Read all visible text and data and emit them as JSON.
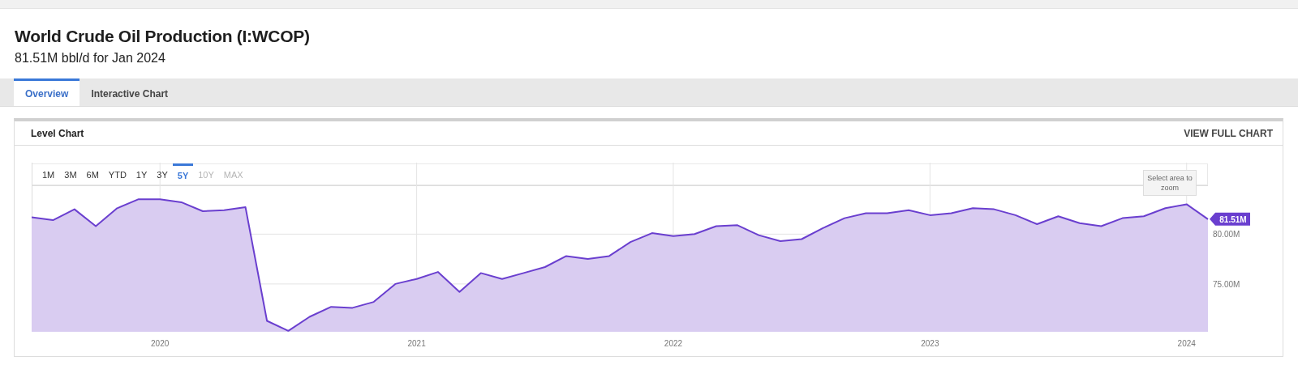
{
  "header": {
    "title": "World Crude Oil Production (I:WCOP)",
    "subtitle": "81.51M bbl/d for Jan 2024"
  },
  "tabs": [
    {
      "label": "Overview",
      "selected": true
    },
    {
      "label": "Interactive Chart",
      "selected": false
    }
  ],
  "card": {
    "title": "Level Chart",
    "action": "VIEW FULL CHART",
    "ranges": [
      {
        "label": "1M",
        "selected": false,
        "disabled": false
      },
      {
        "label": "3M",
        "selected": false,
        "disabled": false
      },
      {
        "label": "6M",
        "selected": false,
        "disabled": false
      },
      {
        "label": "YTD",
        "selected": false,
        "disabled": false
      },
      {
        "label": "1Y",
        "selected": false,
        "disabled": false
      },
      {
        "label": "3Y",
        "selected": false,
        "disabled": false
      },
      {
        "label": "5Y",
        "selected": true,
        "disabled": false
      },
      {
        "label": "10Y",
        "selected": false,
        "disabled": true
      },
      {
        "label": "MAX",
        "selected": false,
        "disabled": true
      }
    ],
    "zoom_hint": "Select area to zoom",
    "current_value": "81.51M",
    "chart_data": {
      "type": "area",
      "x": [
        2019.5,
        2019.583,
        2019.667,
        2019.75,
        2019.833,
        2019.917,
        2020,
        2020.083,
        2020.167,
        2020.25,
        2020.333,
        2020.417,
        2020.5,
        2020.583,
        2020.667,
        2020.75,
        2020.833,
        2020.917,
        2021,
        2021.083,
        2021.167,
        2021.25,
        2021.333,
        2021.417,
        2021.5,
        2021.583,
        2021.667,
        2021.75,
        2021.833,
        2021.917,
        2022,
        2022.083,
        2022.167,
        2022.25,
        2022.333,
        2022.417,
        2022.5,
        2022.583,
        2022.667,
        2022.75,
        2022.833,
        2022.917,
        2023,
        2023.083,
        2023.167,
        2023.25,
        2023.333,
        2023.417,
        2023.5,
        2023.583,
        2023.667,
        2023.75,
        2023.833,
        2023.917,
        2024,
        2024.083
      ],
      "series": [
        {
          "color": "#6a3fcf",
          "values": [
            81.7,
            81.4,
            82.5,
            80.8,
            82.6,
            83.5,
            83.5,
            83.2,
            82.3,
            82.4,
            82.7,
            71.3,
            70.3,
            71.7,
            72.7,
            72.6,
            73.2,
            75.0,
            75.5,
            76.2,
            74.2,
            76.1,
            75.5,
            76.1,
            76.7,
            77.8,
            77.5,
            77.8,
            79.2,
            80.1,
            79.8,
            80.0,
            80.8,
            80.9,
            79.9,
            79.3,
            79.5,
            80.6,
            81.6,
            82.1,
            82.1,
            82.4,
            81.9,
            82.1,
            82.6,
            82.5,
            81.9,
            81.0,
            81.8,
            81.1,
            80.8,
            81.6,
            81.8,
            82.6,
            83.0,
            81.5
          ]
        }
      ],
      "xlim": [
        2019.5,
        2024.083
      ],
      "ylim": [
        70.2,
        84.9
      ],
      "grid": true,
      "xticks": [
        2020,
        2021,
        2022,
        2023,
        2024
      ],
      "yticks": [
        {
          "value": 75,
          "label": "75.00M"
        },
        {
          "value": 80,
          "label": "80.00M"
        }
      ]
    }
  }
}
